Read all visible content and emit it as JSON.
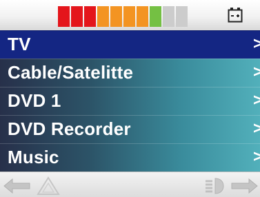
{
  "status_bar": {
    "signal_segment_colors": [
      "#e4151b",
      "#e4151b",
      "#e4151b",
      "#f39422",
      "#f39422",
      "#f39422",
      "#f39422",
      "#74c043",
      "#cccccc",
      "#cccccc"
    ],
    "battery_icon": "battery-icon"
  },
  "menu": {
    "items": [
      {
        "label": "TV",
        "arrow": ">",
        "selected": true
      },
      {
        "label": "Cable/Satelitte",
        "arrow": ">"
      },
      {
        "label": "DVD 1",
        "arrow": ">"
      },
      {
        "label": "DVD Recorder",
        "arrow": ">"
      },
      {
        "label": "Music",
        "arrow": ">"
      }
    ]
  },
  "nav_bar": {
    "icons": [
      "back-arrow-icon",
      "warning-icon",
      "light-icon",
      "forward-arrow-icon"
    ]
  }
}
